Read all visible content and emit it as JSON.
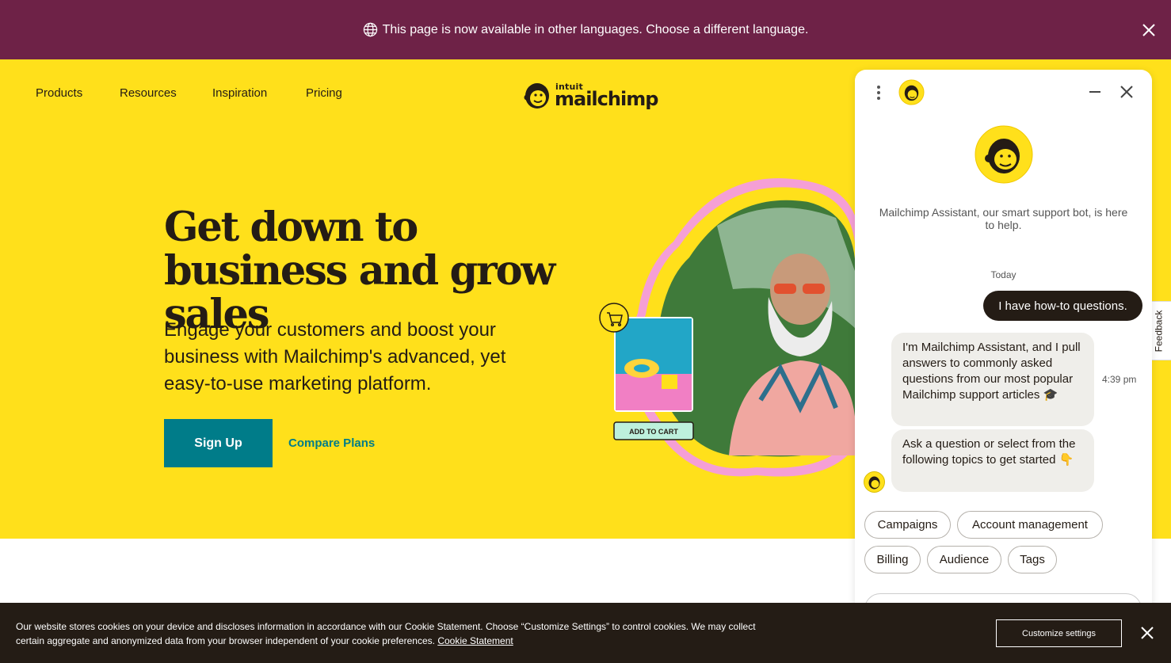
{
  "banner": {
    "message": "This page is now available in other languages. Choose a different language.",
    "background": "#6e2247"
  },
  "nav": {
    "items": [
      {
        "label": "Products"
      },
      {
        "label": "Resources"
      },
      {
        "label": "Inspiration"
      },
      {
        "label": "Pricing"
      }
    ],
    "logo": {
      "top": "intuit",
      "main": "mailchimp"
    }
  },
  "hero": {
    "title": "Get down to business and grow sales",
    "subtitle": "Engage your customers and boost your business with Mailchimp's advanced, yet easy-to-use marketing platform.",
    "signup_label": "Sign Up",
    "compare_label": "Compare Plans",
    "art": {
      "add_to_cart_label": "ADD TO CART"
    }
  },
  "colors": {
    "brand_yellow": "#ffe01b",
    "teal": "#007c89",
    "dark": "#241c15",
    "pink": "#f59fd5"
  },
  "feedback": {
    "label": "Feedback"
  },
  "chat": {
    "intro": "Mailchimp Assistant, our smart support bot, is here to help.",
    "date_label": "Today",
    "user_message": "I have how-to questions.",
    "bot_messages": [
      "I'm Mailchimp Assistant, and I pull answers to commonly asked questions from our most popular Mailchimp support articles 🎓",
      "Ask a question or select from the following topics to get started 👇"
    ],
    "timestamp": "4:39 pm",
    "topics": [
      "Campaigns",
      "Account management",
      "Billing",
      "Audience",
      "Tags"
    ]
  },
  "cookie": {
    "text": "Our website stores cookies on your device and discloses information in accordance with our Cookie Statement. Choose “Customize Settings” to control cookies. We may collect certain aggregate and anonymized data from your browser independent of your cookie preferences.",
    "link_label": "Cookie Statement",
    "button_label": "Customize settings"
  }
}
